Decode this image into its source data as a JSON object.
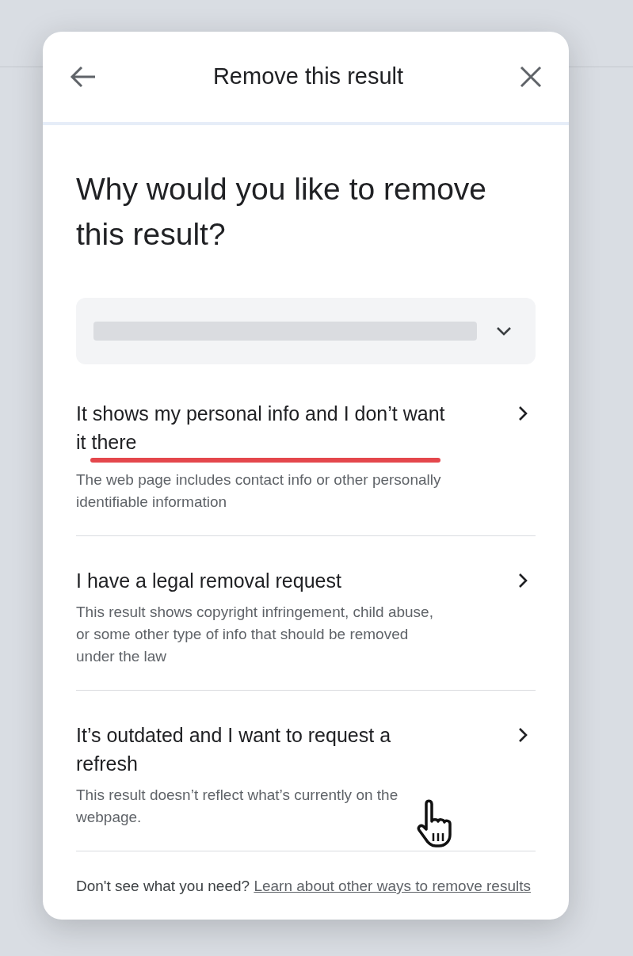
{
  "dialog": {
    "title": "Remove this result"
  },
  "heading": "Why would you like to remove this result?",
  "dropdown": {
    "expanded": false
  },
  "options": [
    {
      "title": "It shows my personal info and I don’t want it there",
      "description": "The web page includes contact info or other personally identifiable information",
      "highlighted": true
    },
    {
      "title": "I have a legal removal request",
      "description": "This result shows copyright infringement, child abuse, or some other type of info that should be removed under the law",
      "highlighted": false
    },
    {
      "title": "It’s outdated and I want to request a refresh",
      "description": "This result doesn’t reflect what’s currently on the webpage.",
      "highlighted": false
    }
  ],
  "footer": {
    "text": "Don't see what you need?",
    "link": "Learn about other ways to remove results"
  }
}
